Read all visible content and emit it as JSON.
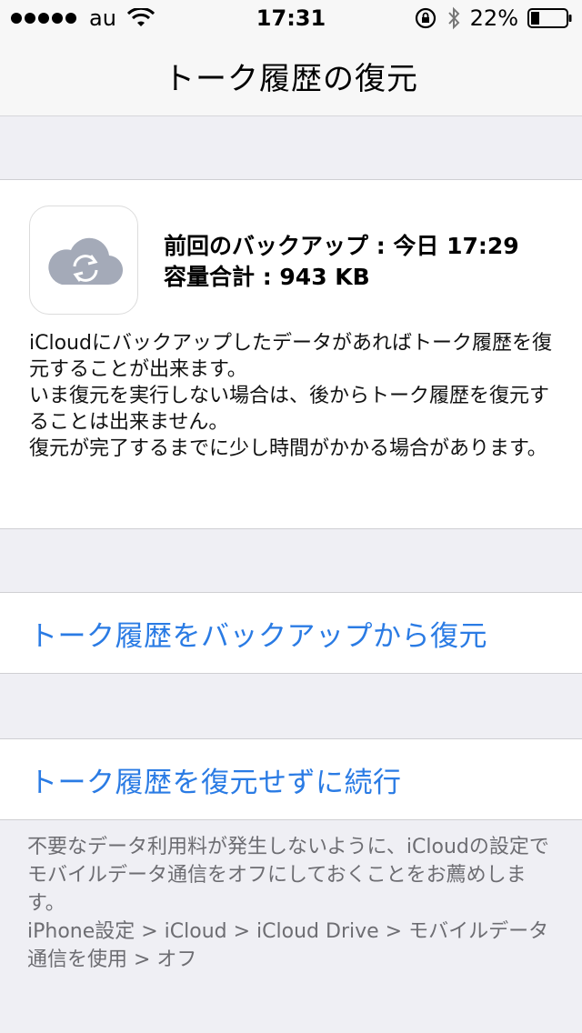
{
  "status_bar": {
    "carrier": "au",
    "time": "17:31",
    "battery": "22%",
    "icons": [
      "signal-dots",
      "wifi-icon",
      "rotation-lock-icon",
      "bluetooth-icon",
      "battery-icon"
    ]
  },
  "nav": {
    "title": "トーク履歴の復元"
  },
  "backup": {
    "last_backup": "前回のバックアップ : 今日 17:29",
    "total_size": "容量合計 : 943 KB",
    "icon": "cloud-sync-icon",
    "icon_color": "#a4aab8"
  },
  "description": {
    "line1": "iCloudにバックアップしたデータがあればトーク履歴を復元することが出来ます。",
    "line2": "いま復元を実行しない場合は、後からトーク履歴を復元することは出来ません。",
    "line3": "復元が完了するまでに少し時間がかかる場合があります。"
  },
  "actions": {
    "restore": "トーク履歴をバックアップから復元",
    "continue": "トーク履歴を復元せずに続行",
    "color": "#2a7be4"
  },
  "footer": {
    "note": "不要なデータ利用料が発生しないように、iCloudの設定でモバイルデータ通信をオフにしておくことをお薦めします。",
    "path": "iPhone設定 > iCloud > iCloud Drive > モバイルデータ通信を使用 > オフ"
  }
}
